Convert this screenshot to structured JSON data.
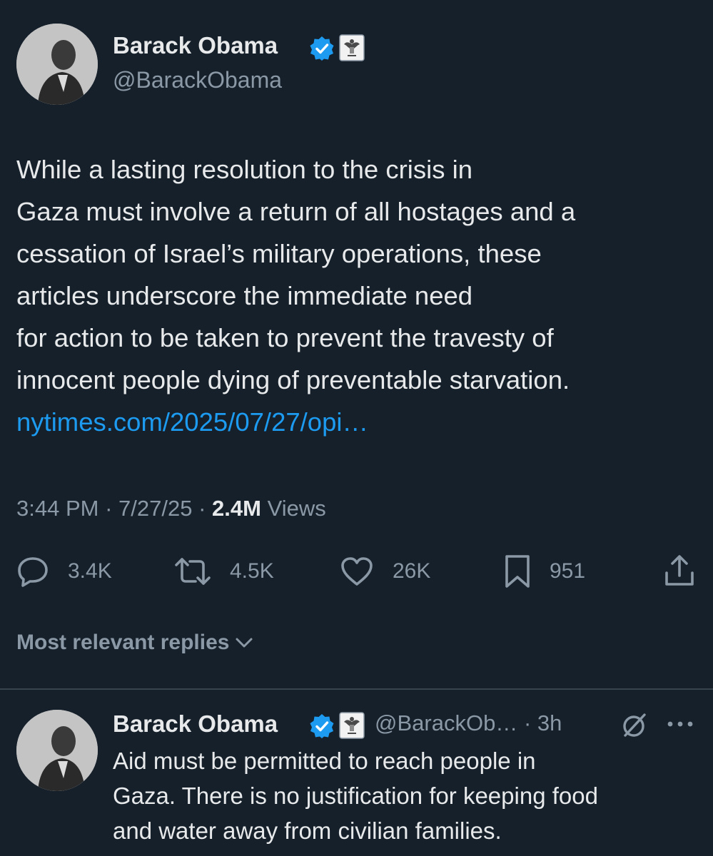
{
  "main_tweet": {
    "author_name": "Barack Obama",
    "author_handle": "@BarackObama",
    "text_lines": [
      "While a lasting resolution to the crisis in",
      "Gaza must involve a return of all hostages and a",
      "cessation of Israel’s military operations, these",
      "articles underscore the immediate need",
      "for action to be taken to prevent the travesty of",
      "innocent people dying of preventable starvation."
    ],
    "link": "nytimes.com/2025/07/27/opi…",
    "time": "3:44 PM",
    "date": "7/27/25",
    "separator": "·",
    "views_count": "2.4M",
    "views_label": "Views",
    "stats": {
      "replies": "3.4K",
      "reposts": "4.5K",
      "likes": "26K",
      "bookmarks": "951"
    }
  },
  "replies_filter": {
    "label": "Most relevant replies"
  },
  "reply": {
    "author_name": "Barack Obama",
    "author_handle": "@BarackOb…",
    "separator": "·",
    "time": "3h",
    "text_lines": [
      "Aid must be permitted to reach people in",
      "Gaza. There is no justification for keeping food",
      "and water away from civilian families."
    ]
  },
  "icons": {
    "verified": "verified-badge-icon",
    "affiliate": "government-seal-icon",
    "reply": "reply-icon",
    "repost": "repost-icon",
    "like": "heart-icon",
    "bookmark": "bookmark-icon",
    "share": "share-icon",
    "grok": "grok-icon",
    "more": "more-icon",
    "chevron": "chevron-down-icon"
  },
  "colors": {
    "background": "#15202b",
    "text": "#e7e9ea",
    "secondary": "#8b98a5",
    "link": "#1d9bf0",
    "verified": "#1d9bf0"
  }
}
